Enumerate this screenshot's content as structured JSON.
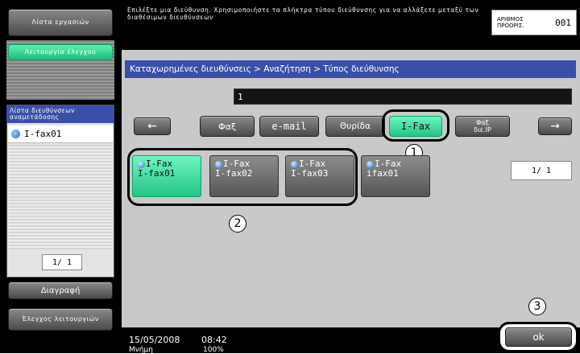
{
  "left_panel": {
    "job_list_button": "Λίστα εργασιών",
    "function_check_button": "Λειτουργία έλεγχου",
    "broadcast_list_title": "Λίστα διευθύνσεων αναμετάδοσης",
    "broadcast_items": [
      {
        "label": "I-fax01"
      }
    ],
    "page_indicator": "1/ 1",
    "delete_button": "Διαγραφή",
    "check_function_button": "Έλεγχος λειτουργιών"
  },
  "header": {
    "instruction": "Επιλέξτε μια διεύθυνση. Χρησιμοποιήστε τα πλήκτρα τύπου διεύθυνσης για να αλλάξετε μεταξύ των διαθέσιμων διευθύνσεων",
    "dest_count_label": "ΑΡΙΘΜΟΣ ΠΡΟΟΡΙΣ.",
    "dest_count_value": "001"
  },
  "breadcrumb": "Καταχωρημένες διευθύνσεις > Αναζήτηση > Τύπος διεύθυνσης",
  "search_value": "1",
  "type_tabs": {
    "prev": "←",
    "next": "→",
    "fax": "Φαξ",
    "email": "e-mail",
    "box": "Θυρίδα",
    "ifax": "I-Fax",
    "ipfax_line1": "Φαξ",
    "ipfax_line2": "διε.IP"
  },
  "addresses": [
    {
      "type": "I-Fax",
      "name": "I-fax01",
      "selected": true
    },
    {
      "type": "I-Fax",
      "name": "I-fax02",
      "selected": false
    },
    {
      "type": "I-Fax",
      "name": "I-fax03",
      "selected": false
    },
    {
      "type": "I-Fax",
      "name": "ifax01",
      "selected": false
    }
  ],
  "right_page_indicator": "1/ 1",
  "callouts": {
    "one": "1",
    "two": "2",
    "three": "3"
  },
  "status": {
    "date": "15/05/2008",
    "time": "08:42",
    "memory_label": "Μνήμη",
    "memory_value": "100%"
  },
  "ok_button": "ok",
  "colors": {
    "accent_green": "#2ed69a",
    "panel_blue": "#3a50a8"
  }
}
